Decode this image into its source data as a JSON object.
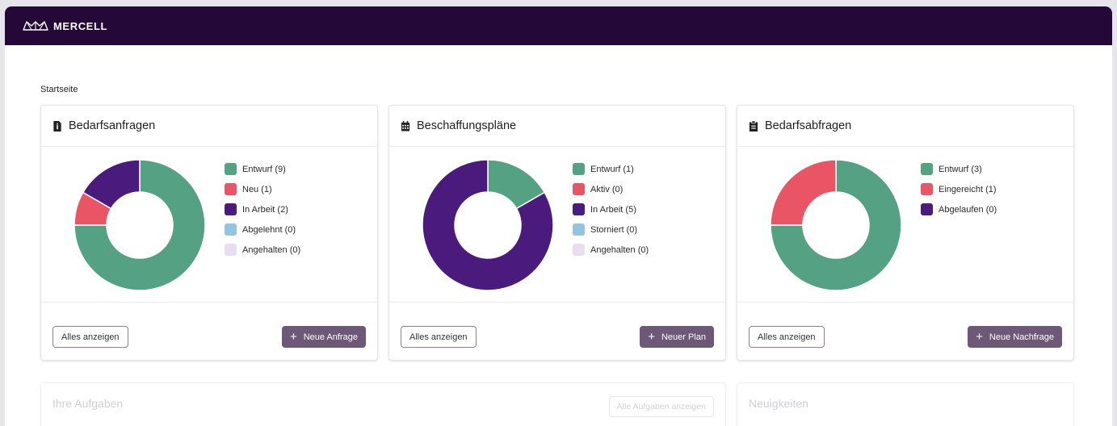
{
  "brand": {
    "name": "MERCELL",
    "logo_icon": "mercell-logo-icon"
  },
  "breadcrumb": "Startseite",
  "cards": [
    {
      "title": "Bedarfsanfragen",
      "icon": "file-info-icon",
      "legend": [
        {
          "label": "Entwurf (9)",
          "value": 9,
          "color": "#54a283"
        },
        {
          "label": "Neu (1)",
          "value": 1,
          "color": "#ea5565"
        },
        {
          "label": "In Arbeit (2)",
          "value": 2,
          "color": "#4a1a7c"
        },
        {
          "label": "Abgelehnt (0)",
          "value": 0,
          "color": "#93c4e0"
        },
        {
          "label": "Angehalten (0)",
          "value": 0,
          "color": "#e9def0"
        }
      ],
      "show_all": "Alles anzeigen",
      "action": "Neue Anfrage"
    },
    {
      "title": "Beschaffungspläne",
      "icon": "calendar-icon",
      "legend": [
        {
          "label": "Entwurf (1)",
          "value": 1,
          "color": "#54a283"
        },
        {
          "label": "Aktiv (0)",
          "value": 0,
          "color": "#ea5565"
        },
        {
          "label": "In Arbeit (5)",
          "value": 5,
          "color": "#4a1a7c"
        },
        {
          "label": "Storniert (0)",
          "value": 0,
          "color": "#93c4e0"
        },
        {
          "label": "Angehalten (0)",
          "value": 0,
          "color": "#e9def0"
        }
      ],
      "show_all": "Alles anzeigen",
      "action": "Neuer Plan"
    },
    {
      "title": "Bedarfsabfragen",
      "icon": "clipboard-icon",
      "legend": [
        {
          "label": "Entwurf (3)",
          "value": 3,
          "color": "#54a283"
        },
        {
          "label": "Eingereicht (1)",
          "value": 1,
          "color": "#ea5565"
        },
        {
          "label": "Abgelaufen (0)",
          "value": 0,
          "color": "#4a1a7c"
        }
      ],
      "show_all": "Alles anzeigen",
      "action": "Neue Nachfrage"
    }
  ],
  "tasks": {
    "title": "Ihre Aufgaben",
    "show_all": "Alle Aufgaben anzeigen"
  },
  "news": {
    "title": "Neuigkeiten"
  }
}
